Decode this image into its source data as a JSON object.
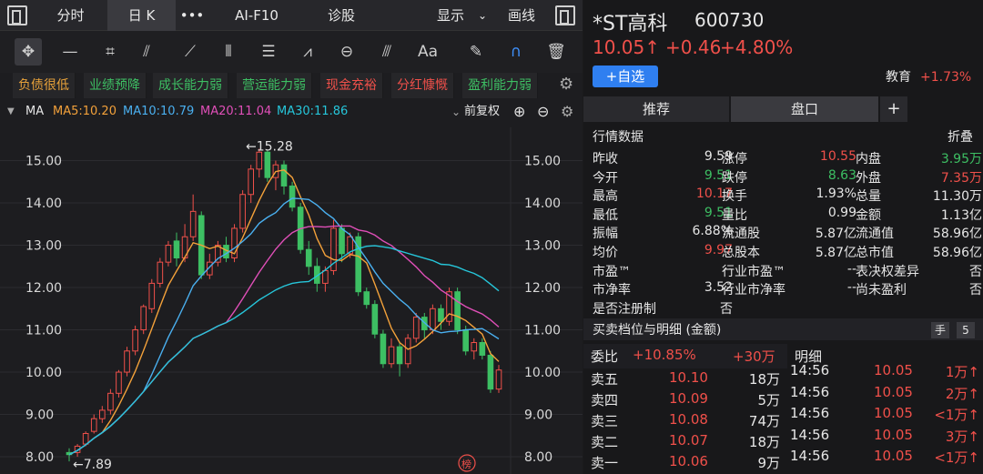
{
  "tabs": {
    "time_share": "分时",
    "day_k": "日 K",
    "more": "•••",
    "f10": "AI-F10",
    "diagnose": "诊股",
    "display": "显示",
    "draw": "画线"
  },
  "tools": [
    "cross-cursor",
    "horizontal-line",
    "rect-select",
    "fan-lines",
    "segment-line",
    "parallel-channel",
    "fibonacci",
    "wave",
    "cycle",
    "gann",
    "text",
    "eraser",
    "magnet",
    "trash"
  ],
  "tags": [
    {
      "label": "负债很低",
      "color": "#e8a23a"
    },
    {
      "label": "业绩预降",
      "color": "#3dbf63"
    },
    {
      "label": "成长能力弱",
      "color": "#3dbf63"
    },
    {
      "label": "营运能力弱",
      "color": "#3dbf63"
    },
    {
      "label": "现金充裕",
      "color": "#f0504a"
    },
    {
      "label": "分红慷慨",
      "color": "#f0504a"
    },
    {
      "label": "盈利能力弱",
      "color": "#3dbf63"
    }
  ],
  "ma": {
    "label": "MA",
    "ma5": "MA5:10.20",
    "ma10": "MA10:10.79",
    "ma20": "MA20:11.04",
    "ma30": "MA30:11.86",
    "adjust": "前复权",
    "colors": {
      "ma5": "#f3a13a",
      "ma10": "#4ab0f0",
      "ma20": "#e04fb8",
      "ma30": "#26c6da"
    }
  },
  "stock": {
    "name": "*ST高科",
    "code": "600730",
    "price": "10.05↑",
    "change": "+0.46",
    "pct": "+4.80%",
    "add": "+自选",
    "sector": "教育",
    "sector_pct": "+1.73%"
  },
  "panel_tabs": {
    "recommend": "推荐",
    "orderbook": "盘口",
    "plus": "+"
  },
  "quote_title": "行情数据",
  "quote_fold": "折叠",
  "quote_rows": [
    [
      "昨收",
      "9.59",
      "white",
      "涨停",
      "10.55",
      "red",
      "内盘",
      "3.95万",
      "green"
    ],
    [
      "今开",
      "9.51",
      "green",
      "跌停",
      "8.63",
      "green",
      "外盘",
      "7.35万",
      "red"
    ],
    [
      "最高",
      "10.17",
      "red",
      "换手",
      "1.93%",
      "white",
      "总量",
      "11.30万",
      "white"
    ],
    [
      "最低",
      "9.51",
      "green",
      "量比",
      "0.99",
      "white",
      "金额",
      "1.13亿",
      "white"
    ],
    [
      "振幅",
      "6.88%",
      "white",
      "流通股",
      "5.87亿",
      "white",
      "流通值",
      "58.96亿",
      "white"
    ],
    [
      "均价",
      "9.97",
      "red",
      "总股本",
      "5.87亿",
      "white",
      "总市值",
      "58.96亿",
      "white"
    ],
    [
      "市盈™",
      "--",
      "white",
      "行业市盈™",
      "--",
      "white",
      "表决权差异",
      "否",
      "white"
    ],
    [
      "市净率",
      "3.52",
      "white",
      "行业市净率",
      "--",
      "white",
      "尚未盈利",
      "否",
      "white"
    ],
    [
      "是否注册制",
      "否",
      "white",
      "",
      "",
      "",
      "",
      "",
      ""
    ]
  ],
  "depth_title": "买卖档位与明细 (金额)",
  "depth_hand": "手",
  "depth_num": "5",
  "order_ratio": {
    "label": "委比",
    "pct": "+10.85%",
    "amt": "+30万"
  },
  "detail_title": "明细",
  "asks": [
    [
      "卖五",
      "10.10",
      "18万"
    ],
    [
      "卖四",
      "10.09",
      "5万"
    ],
    [
      "卖三",
      "10.08",
      "74万"
    ],
    [
      "卖二",
      "10.07",
      "18万"
    ],
    [
      "卖一",
      "10.06",
      "9万"
    ]
  ],
  "details": [
    [
      "14:56",
      "10.05",
      "1万↑"
    ],
    [
      "14:56",
      "10.05",
      "2万↑"
    ],
    [
      "14:56",
      "10.05",
      "<1万↑"
    ],
    [
      "14:56",
      "10.05",
      "3万↑"
    ],
    [
      "14:56",
      "10.05",
      "<1万↑"
    ]
  ],
  "chart_data": {
    "type": "candlestick",
    "ylim": [
      7.7,
      15.7
    ],
    "yticks": [
      "15.00",
      "14.00",
      "13.00",
      "12.00",
      "11.00",
      "10.00",
      "9.00",
      "8.00"
    ],
    "high_label": "←15.28",
    "low_label": "←7.89",
    "badge": "榜",
    "candles": [
      [
        8.1,
        8.05,
        8.2,
        7.89
      ],
      [
        8.1,
        8.25,
        8.3,
        8.0
      ],
      [
        8.3,
        8.55,
        8.6,
        8.25
      ],
      [
        8.6,
        8.9,
        9.0,
        8.55
      ],
      [
        8.9,
        9.1,
        9.2,
        8.8
      ],
      [
        9.1,
        9.5,
        9.6,
        9.0
      ],
      [
        9.5,
        10.0,
        10.05,
        9.4
      ],
      [
        10.0,
        10.5,
        10.6,
        9.9
      ],
      [
        10.5,
        11.0,
        11.1,
        10.4
      ],
      [
        11.0,
        11.55,
        11.6,
        10.9
      ],
      [
        11.5,
        12.1,
        12.2,
        11.4
      ],
      [
        12.1,
        12.6,
        12.7,
        12.0
      ],
      [
        12.6,
        13.0,
        13.1,
        12.5
      ],
      [
        13.1,
        12.7,
        13.3,
        12.5
      ],
      [
        12.7,
        13.2,
        13.5,
        12.6
      ],
      [
        13.2,
        13.8,
        14.2,
        13.1
      ],
      [
        13.7,
        12.3,
        13.8,
        12.2
      ],
      [
        12.3,
        12.6,
        12.8,
        12.2
      ],
      [
        12.6,
        13.0,
        13.1,
        12.5
      ],
      [
        13.0,
        12.7,
        13.2,
        12.6
      ],
      [
        12.7,
        13.4,
        13.5,
        12.6
      ],
      [
        13.4,
        14.2,
        14.3,
        13.3
      ],
      [
        14.2,
        14.8,
        14.9,
        14.0
      ],
      [
        14.8,
        15.2,
        15.28,
        14.6
      ],
      [
        15.2,
        14.6,
        15.25,
        14.5
      ],
      [
        14.6,
        14.9,
        15.0,
        14.3
      ],
      [
        14.9,
        14.4,
        15.0,
        14.2
      ],
      [
        14.4,
        13.9,
        14.5,
        13.8
      ],
      [
        13.9,
        12.9,
        14.0,
        12.8
      ],
      [
        12.9,
        12.5,
        13.1,
        12.3
      ],
      [
        12.5,
        12.1,
        12.7,
        11.9
      ],
      [
        12.1,
        12.4,
        12.5,
        11.9
      ],
      [
        12.4,
        13.4,
        13.6,
        12.3
      ],
      [
        13.4,
        12.8,
        13.5,
        12.6
      ],
      [
        12.8,
        13.2,
        13.3,
        12.7
      ],
      [
        13.2,
        11.9,
        13.3,
        11.8
      ],
      [
        11.9,
        11.6,
        12.0,
        11.5
      ],
      [
        11.6,
        10.9,
        11.7,
        10.8
      ],
      [
        10.9,
        10.2,
        11.0,
        10.1
      ],
      [
        10.2,
        10.6,
        10.8,
        10.1
      ],
      [
        10.6,
        10.2,
        10.7,
        9.9
      ],
      [
        10.2,
        10.8,
        10.9,
        10.1
      ],
      [
        10.8,
        11.3,
        11.4,
        10.7
      ],
      [
        11.3,
        11.0,
        11.4,
        10.8
      ],
      [
        11.0,
        11.5,
        11.6,
        10.9
      ],
      [
        11.5,
        11.2,
        11.6,
        11.0
      ],
      [
        11.2,
        11.9,
        12.0,
        11.1
      ],
      [
        11.9,
        11.0,
        12.0,
        10.9
      ],
      [
        11.0,
        10.5,
        11.1,
        10.4
      ],
      [
        10.5,
        10.7,
        10.8,
        10.3
      ],
      [
        10.7,
        10.4,
        10.8,
        10.3
      ],
      [
        10.4,
        9.6,
        10.5,
        9.51
      ],
      [
        9.6,
        10.05,
        10.17,
        9.51
      ]
    ]
  }
}
